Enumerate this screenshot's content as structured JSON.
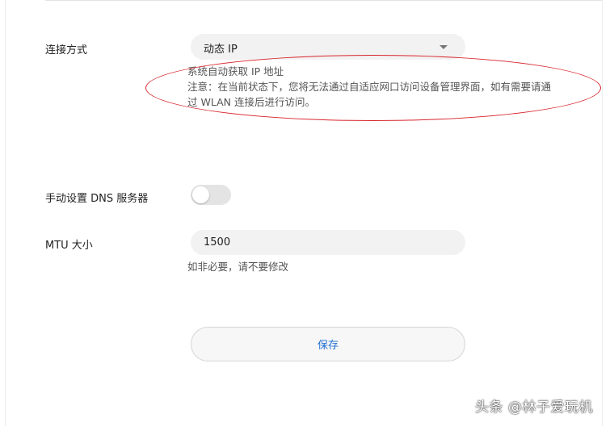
{
  "connection": {
    "label": "连接方式",
    "selected": "动态 IP",
    "hint_line1": "系统自动获取 IP 地址",
    "hint_line2": "注意：在当前状态下，您将无法通过自适应网口访问设备管理界面，如有需要请通",
    "hint_line3": "过 WLAN 连接后进行访问。"
  },
  "dns": {
    "label": "手动设置 DNS 服务器",
    "enabled": false
  },
  "mtu": {
    "label": "MTU 大小",
    "value": "1500",
    "hint": "如非必要，请不要修改"
  },
  "actions": {
    "save_label": "保存"
  },
  "watermark": "头条 @林子爱玩机",
  "colors": {
    "accent": "#1f6fd1",
    "annotation": "#d8262c",
    "field_bg": "#f2f2f2"
  },
  "icons": {
    "select_caret": "chevron-down-icon"
  }
}
